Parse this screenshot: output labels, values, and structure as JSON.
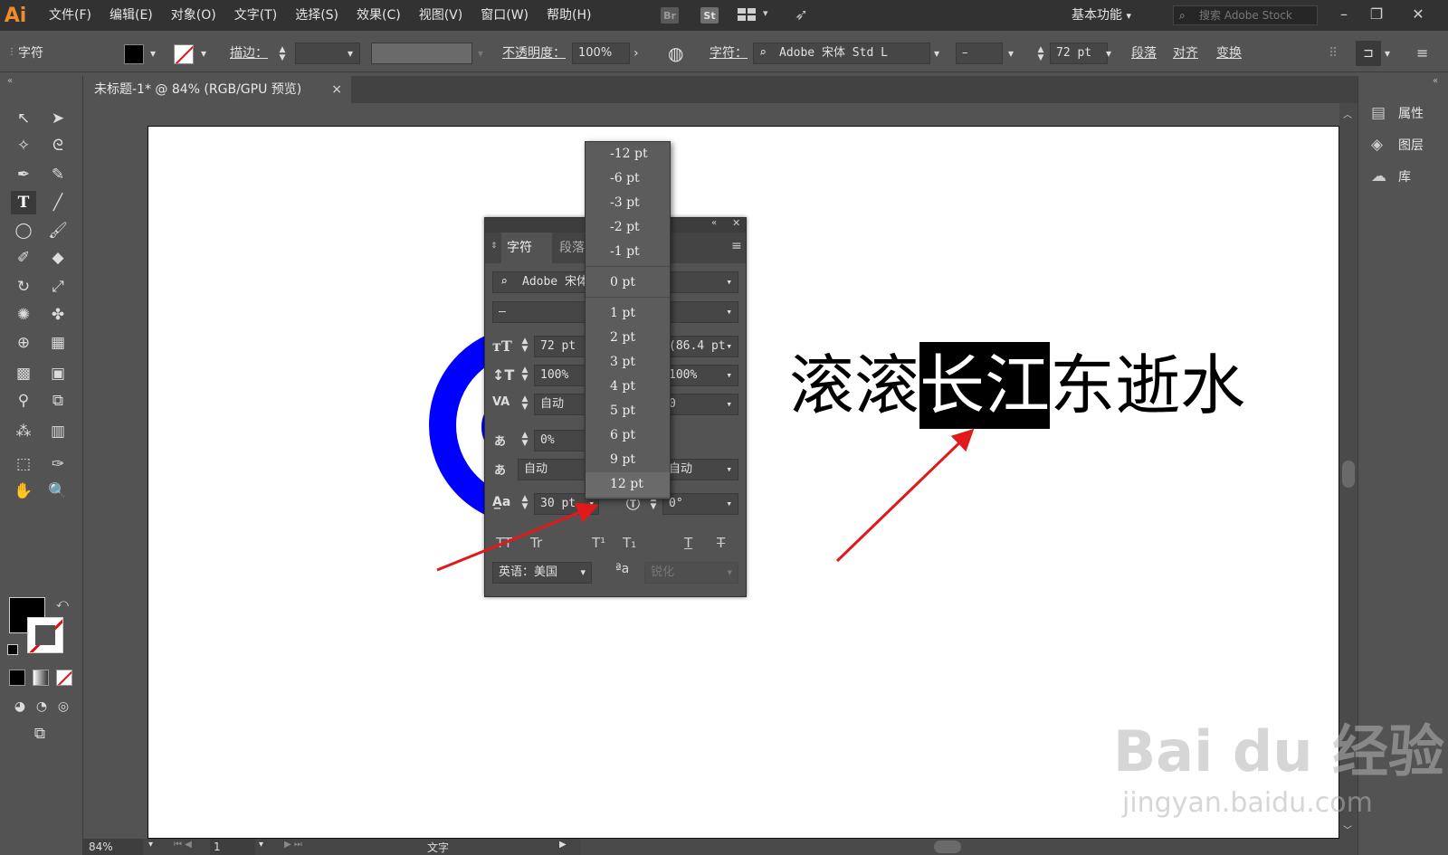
{
  "app": {
    "logo": "Ai"
  },
  "menubar": {
    "items": [
      "文件(F)",
      "编辑(E)",
      "对象(O)",
      "文字(T)",
      "选择(S)",
      "效果(C)",
      "视图(V)",
      "窗口(W)",
      "帮助(H)"
    ],
    "bridge": "Br",
    "stock": "St",
    "workspace": "基本功能",
    "search_placeholder": "搜索 Adobe Stock"
  },
  "controlbar": {
    "context": "字符",
    "stroke_label": "描边：",
    "opacity_label": "不透明度：",
    "opacity_value": "100%",
    "char_label": "字符：",
    "font_value": "Adobe 宋体 Std L",
    "style_value": "–",
    "size_value": "72 pt",
    "paragraph_label": "段落",
    "align_label": "对齐",
    "transform_label": "变换"
  },
  "document": {
    "tab_title": "未标题-1* @ 84% (RGB/GPU 预览)",
    "close": "×"
  },
  "artwork": {
    "poem": [
      "滚",
      "滚",
      "长",
      "江",
      "东",
      "逝",
      "水"
    ],
    "selected_chars": "长江",
    "ring_color": "#0000ff"
  },
  "character_panel": {
    "tab_char": "字符",
    "tab_para": "段落",
    "font_value": "Adobe 宋体",
    "style_value": "–",
    "size_value": "72 pt",
    "leading_value": "(86.4 pt)",
    "vscale_value": "100%",
    "hscale_value": "100%",
    "kerning_value": "自动",
    "tracking_value": "0",
    "tsume_value": "0%",
    "aki_left": "自动",
    "aki_right": "自动",
    "baseline_value": "30 pt",
    "rotation_value": "0°",
    "language_value": "英语：美国",
    "antialias_value": "锐化"
  },
  "baseline_dropdown": {
    "options": [
      "-12 pt",
      "-6 pt",
      "-3 pt",
      "-2 pt",
      "-1 pt",
      "0 pt",
      "1 pt",
      "2 pt",
      "3 pt",
      "4 pt",
      "5 pt",
      "6 pt",
      "9 pt",
      "12 pt"
    ],
    "highlighted": "12 pt"
  },
  "right_dock": {
    "properties": "属性",
    "layers": "图层",
    "libraries": "库"
  },
  "statusbar": {
    "zoom": "84%",
    "artboard_num": "1",
    "tool": "文字"
  },
  "watermark": {
    "brand": "Bai du 经验",
    "url": "jingyan.baidu.com"
  },
  "colors": {
    "accent": "#f08c28",
    "arrow": "#e01a1a",
    "ring": "#0000ff"
  }
}
